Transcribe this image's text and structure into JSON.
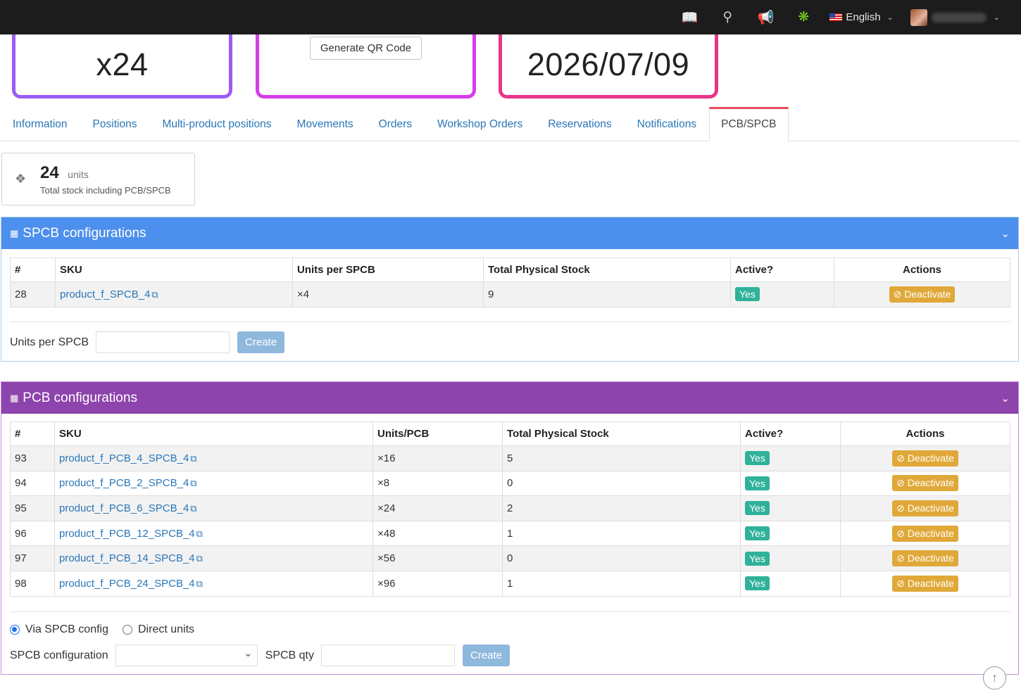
{
  "topbar": {
    "icons": [
      "book-icon",
      "search-icon",
      "megaphone-icon",
      "bug-icon"
    ],
    "language": "English"
  },
  "cards": {
    "quantity": "x24",
    "qr_button": "Generate QR Code",
    "date": "2026/07/09"
  },
  "tabs": [
    "Information",
    "Positions",
    "Multi-product positions",
    "Movements",
    "Orders",
    "Workshop Orders",
    "Reservations",
    "Notifications",
    "PCB/SPCB"
  ],
  "stock_box": {
    "value": "24",
    "unit": "units",
    "description": "Total stock including PCB/SPCB"
  },
  "spcb": {
    "title": "SPCB configurations",
    "headers": [
      "#",
      "SKU",
      "Units per SPCB",
      "Total Physical Stock",
      "Active?",
      "Actions"
    ],
    "rows": [
      {
        "id": "28",
        "sku": "product_f_SPCB_4",
        "units": "×4",
        "stock": "9",
        "active": "Yes",
        "action": "Deactivate"
      }
    ],
    "form_label": "Units per SPCB",
    "create_label": "Create"
  },
  "pcb": {
    "title": "PCB configurations",
    "headers": [
      "#",
      "SKU",
      "Units/PCB",
      "Total Physical Stock",
      "Active?",
      "Actions"
    ],
    "rows": [
      {
        "id": "93",
        "sku": "product_f_PCB_4_SPCB_4",
        "units": "×16",
        "stock": "5",
        "active": "Yes",
        "action": "Deactivate"
      },
      {
        "id": "94",
        "sku": "product_f_PCB_2_SPCB_4",
        "units": "×8",
        "stock": "0",
        "active": "Yes",
        "action": "Deactivate"
      },
      {
        "id": "95",
        "sku": "product_f_PCB_6_SPCB_4",
        "units": "×24",
        "stock": "2",
        "active": "Yes",
        "action": "Deactivate"
      },
      {
        "id": "96",
        "sku": "product_f_PCB_12_SPCB_4",
        "units": "×48",
        "stock": "1",
        "active": "Yes",
        "action": "Deactivate"
      },
      {
        "id": "97",
        "sku": "product_f_PCB_14_SPCB_4",
        "units": "×56",
        "stock": "0",
        "active": "Yes",
        "action": "Deactivate"
      },
      {
        "id": "98",
        "sku": "product_f_PCB_24_SPCB_4",
        "units": "×96",
        "stock": "1",
        "active": "Yes",
        "action": "Deactivate"
      }
    ],
    "radio_via": "Via SPCB config",
    "radio_direct": "Direct units",
    "spcb_config_label": "SPCB configuration",
    "spcb_qty_label": "SPCB qty",
    "create_label": "Create"
  }
}
